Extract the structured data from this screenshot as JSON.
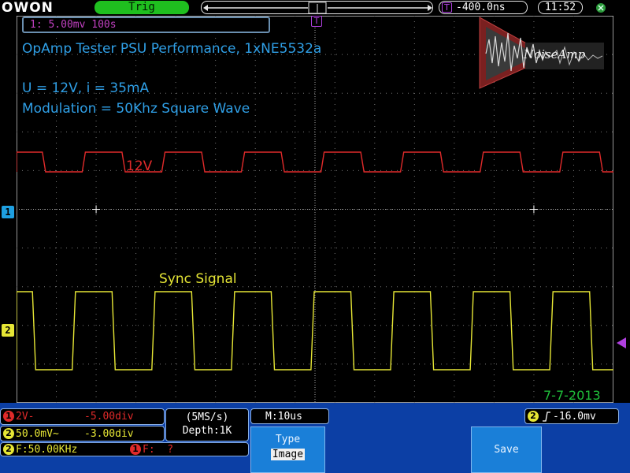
{
  "top": {
    "logo": "OWON",
    "trigger_status": "Trig",
    "time_offset": "-400.0ns",
    "trigger_marker": "T",
    "clock": "11:52"
  },
  "channel_info": "1: 5.00mv 100s",
  "overlay": {
    "title": "OpAmp Tester PSU Performance, 1xNE5532a",
    "line1": "U = 12V, i = 35mA",
    "line2": "Modulation = 50Khz Square Wave",
    "brand": "NoiseAmp",
    "date": "7-7-2013"
  },
  "traces": {
    "ch1_label": "12V",
    "ch2_label": "Sync Signal",
    "ch1_marker": "1",
    "ch2_marker": "2"
  },
  "bottom": {
    "ch1_coupling": "2V-",
    "ch1_offset": "-5.00div",
    "ch2_scale": "50.0mV~",
    "ch2_offset": "-3.00div",
    "sample_rate": "(5MS/s)",
    "depth": "Depth:1K",
    "timebase": "M:10us",
    "trigger_level": "-16.0mv",
    "freq_ch2": "F:50.00KHz",
    "freq_ch1": "F:  ?",
    "type_label": "Type",
    "type_value": "Image",
    "save_label": "Save"
  },
  "colors": {
    "ch1": "#e02a2a",
    "ch2": "#e6e635",
    "text_blue": "#2f9fe6",
    "date_green": "#1fbf3a",
    "trigger_magenta": "#b040e0"
  }
}
